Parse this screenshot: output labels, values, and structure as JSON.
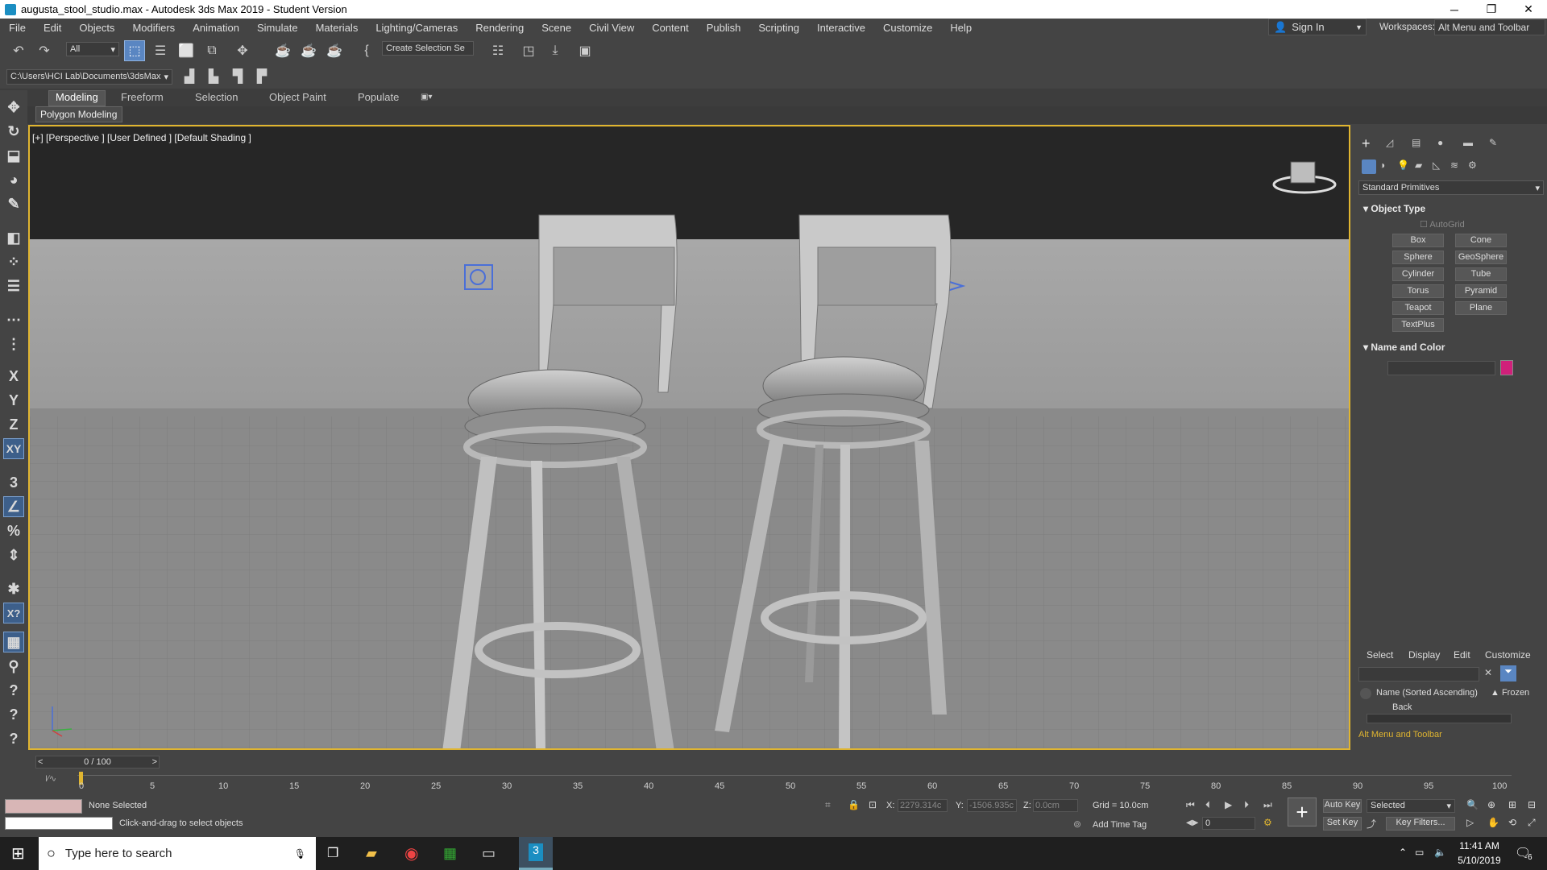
{
  "window": {
    "title": "augusta_stool_studio.max - Autodesk 3ds Max 2019 - Student Version"
  },
  "menu": [
    "File",
    "Edit",
    "Objects",
    "Modifiers",
    "Animation",
    "Simulate",
    "Materials",
    "Lighting/Cameras",
    "Rendering",
    "Scene",
    "Civil View",
    "Content",
    "Publish",
    "Scripting",
    "Interactive",
    "Customize",
    "Help"
  ],
  "account": {
    "sign_in": "Sign In",
    "workspaces_label": "Workspaces:",
    "workspace_value": "Alt Menu and Toolbar"
  },
  "toolbar": {
    "selection_filter": "All",
    "named_selection": "Create Selection Se",
    "project_path": "C:\\Users\\HCI Lab\\Documents\\3dsMax"
  },
  "ribbon": {
    "tabs": [
      "Modeling",
      "Freeform",
      "Selection",
      "Object Paint",
      "Populate"
    ],
    "active_tab": "Modeling",
    "panel": "Polygon Modeling"
  },
  "viewport": {
    "label": "[+] [Perspective ] [User Defined ] [Default Shading ]"
  },
  "command_panel": {
    "category": "Standard Primitives",
    "object_type_title": "Object Type",
    "autogrid": "AutoGrid",
    "buttons": [
      "Box",
      "Cone",
      "Sphere",
      "GeoSphere",
      "Cylinder",
      "Tube",
      "Torus",
      "Pyramid",
      "Teapot",
      "Plane",
      "TextPlus"
    ],
    "name_color_title": "Name and Color",
    "object_color": "#d0207a"
  },
  "scene_explorer": {
    "tabs": [
      "Select",
      "Display",
      "Edit",
      "Customize"
    ],
    "column_name": "Name (Sorted Ascending)",
    "column_frozen": "▲ Frozen",
    "row_item": "Back",
    "layer_explorer": "Alt Menu and Toolbar"
  },
  "timeline": {
    "frame_counter": "0 / 100",
    "ticks": [
      "0",
      "5",
      "10",
      "15",
      "20",
      "25",
      "30",
      "35",
      "40",
      "45",
      "50",
      "55",
      "60",
      "65",
      "70",
      "75",
      "80",
      "85",
      "90",
      "95",
      "100"
    ]
  },
  "status": {
    "selection": "None Selected",
    "prompt": "Click-and-drag to select objects",
    "x_label": "X:",
    "x_value": "2279.314c",
    "y_label": "Y:",
    "y_value": "-1506.935c",
    "z_label": "Z:",
    "z_value": "0.0cm",
    "grid": "Grid = 10.0cm",
    "add_time_tag": "Add Time Tag",
    "auto_key": "Auto Key",
    "key_mode": "Selected",
    "set_key": "Set Key",
    "key_filters": "Key Filters...",
    "frame_value": "0"
  },
  "taskbar": {
    "search_placeholder": "Type here to search",
    "time": "11:41 AM",
    "date": "5/10/2019",
    "notification_count": "6"
  },
  "colors": {
    "accent_yellow": "#e0b530",
    "active_blue": "#5a86c2"
  }
}
